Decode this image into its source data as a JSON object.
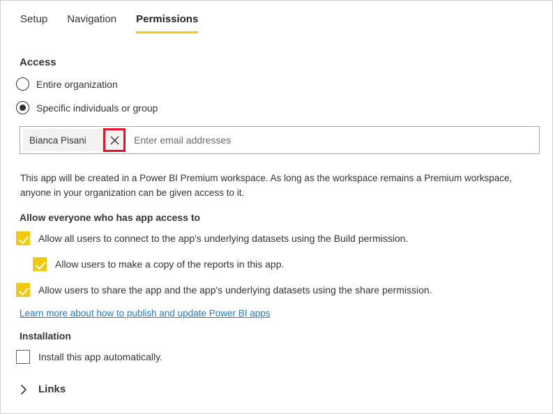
{
  "theme": {
    "accent": "#F2C811",
    "link": "#1a7ad4",
    "annotation": "#E81123",
    "text": "#333333",
    "chip_bg": "#f3f2f1",
    "border": "#a6a6a6"
  },
  "tabs": [
    {
      "label": "Setup",
      "active": false
    },
    {
      "label": "Navigation",
      "active": false
    },
    {
      "label": "Permissions",
      "active": true
    }
  ],
  "access": {
    "heading": "Access",
    "options": [
      {
        "label": "Entire organization",
        "selected": false
      },
      {
        "label": "Specific individuals or group",
        "selected": true
      }
    ],
    "picker": {
      "chips": [
        {
          "name": "Bianca Pisani",
          "remove_icon": "close-icon"
        }
      ],
      "placeholder": "Enter email addresses",
      "value": ""
    },
    "note": "This app will be created in a Power BI Premium workspace. As long as the workspace remains a Premium workspace, anyone in your organization can be given access to it."
  },
  "permissions": {
    "heading": "Allow everyone who has app access to",
    "checkboxes": [
      {
        "label": "Allow all users to connect to the app's underlying datasets using the Build permission.",
        "checked": true
      },
      {
        "label": "Allow users to make a copy of the reports in this app.",
        "checked": true
      },
      {
        "label": "Allow users to share the app and the app's underlying datasets using the share permission.",
        "checked": true
      }
    ],
    "learn_more": "Learn more about how to publish and update Power BI apps"
  },
  "installation": {
    "heading": "Installation",
    "checkbox": {
      "label": "Install this app automatically.",
      "checked": false
    }
  },
  "links_section": {
    "label": "Links",
    "icon": "chevron-right-icon",
    "expanded": false
  }
}
